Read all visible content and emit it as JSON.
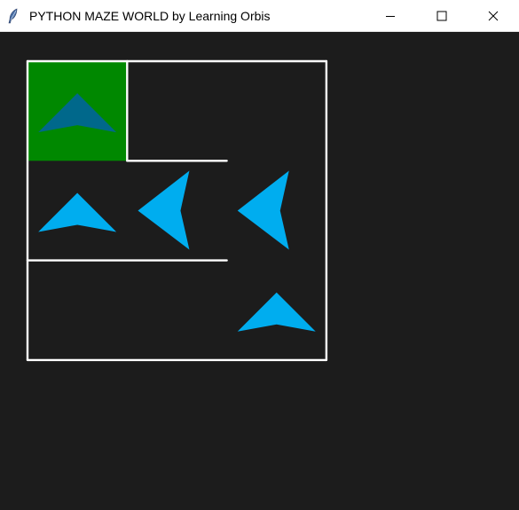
{
  "window": {
    "title": "PYTHON MAZE WORLD by Learning Orbis",
    "app_icon": "feather-icon",
    "controls": [
      "minimize-icon",
      "maximize-icon",
      "close-icon"
    ]
  },
  "maze": {
    "background": "#1c1c1c",
    "wall_color": "#ffffff",
    "goal_color": "#008800",
    "arrow_color": "#00adef",
    "goal_arrow_color": "#00688b",
    "grid_rows": 3,
    "grid_cols": 3,
    "goal_cell": {
      "row": 0,
      "col": 0
    },
    "arrows": [
      {
        "row": 0,
        "col": 0,
        "direction": "up"
      },
      {
        "row": 1,
        "col": 0,
        "direction": "up"
      },
      {
        "row": 1,
        "col": 1,
        "direction": "left"
      },
      {
        "row": 1,
        "col": 2,
        "direction": "left"
      },
      {
        "row": 2,
        "col": 2,
        "direction": "up"
      }
    ]
  }
}
